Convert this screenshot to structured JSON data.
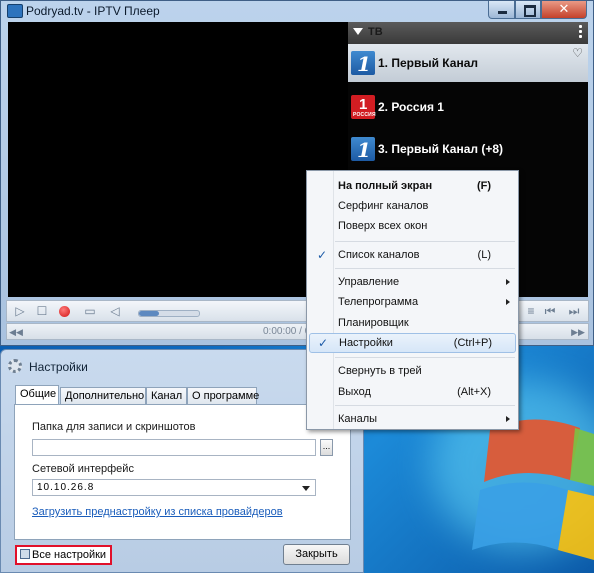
{
  "window": {
    "title": "Podryad.tv - IPTV Плеер"
  },
  "channel_panel": {
    "group_label": "ТВ",
    "channels": [
      {
        "label": "1. Первый Канал",
        "logo": "1",
        "selected": true
      },
      {
        "label": "2. Россия 1",
        "logo": "1",
        "logo_caption": "РОССИЯ",
        "selected": false
      },
      {
        "label": "3. Первый Канал (+8)",
        "logo": "1",
        "selected": false
      }
    ]
  },
  "player": {
    "time": "0:00:00 / 0"
  },
  "context_menu": {
    "items": [
      {
        "label": "На полный экран",
        "shortcut": "(F)",
        "bold": true
      },
      {
        "label": "Серфинг каналов",
        "shortcut": ""
      },
      {
        "label": "Поверх всех окон",
        "shortcut": ""
      },
      {
        "label": "Список каналов",
        "shortcut": "(L)",
        "checked": true
      },
      {
        "label": "Управление",
        "shortcut": "",
        "submenu": true
      },
      {
        "label": "Телепрограмма",
        "shortcut": "",
        "submenu": true
      },
      {
        "label": "Планировщик",
        "shortcut": ""
      },
      {
        "label": "Настройки",
        "shortcut": "(Ctrl+P)",
        "checked": true,
        "highlighted": true
      },
      {
        "label": "Свернуть в трей",
        "shortcut": ""
      },
      {
        "label": "Выход",
        "shortcut": "(Alt+X)"
      },
      {
        "label": "Каналы",
        "shortcut": "",
        "submenu": true
      }
    ]
  },
  "settings_dialog": {
    "title": "Настройки",
    "tabs": [
      "Общие",
      "Дополнительно",
      "Канал",
      "О программе"
    ],
    "folder_label": "Папка для записи и скриншотов",
    "folder_value": "",
    "browse_label": "...",
    "interface_label": "Сетевой интерфейс",
    "interface_value": "10.10.26.8",
    "provider_link": "Загрузить преднастройку из списка провайдеров",
    "all_settings_label": "Все настройки",
    "close_label": "Закрыть"
  },
  "colors": {
    "highlight_border": "#e1102a",
    "link": "#1a5dbb",
    "accent_blue": "#2d73bd"
  }
}
